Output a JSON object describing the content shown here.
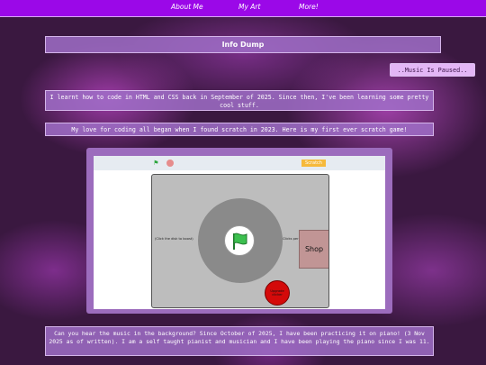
{
  "nav": {
    "items": [
      "About Me",
      "My Art",
      "More!"
    ]
  },
  "title": "Info Dump",
  "music_button": "..Music Is Paused..",
  "para1": "I learnt how to code in HTML and CSS back in September of 2025. Since then, I've been learning some pretty cool stuff.",
  "para2": "My love for coding all began when I found scratch in 2023. Here is my first ever scratch game!",
  "scratch": {
    "logo": "Scratch",
    "left_text": "(Click the disk to boost)",
    "right_text": "Clicks per second",
    "shop": "Shop",
    "red_button": "Upgrade clicker"
  },
  "para3": "Can you hear the music in the background? Since October of 2025, I have been practicing it on piano! (3 Nov 2025 as of written). I am a self taught pianist and musician and I have been playing the piano since I was 11.",
  "colors": {
    "nav": "#9b08e8",
    "panel": "#a06ec8",
    "music": "#e3b6f6"
  }
}
